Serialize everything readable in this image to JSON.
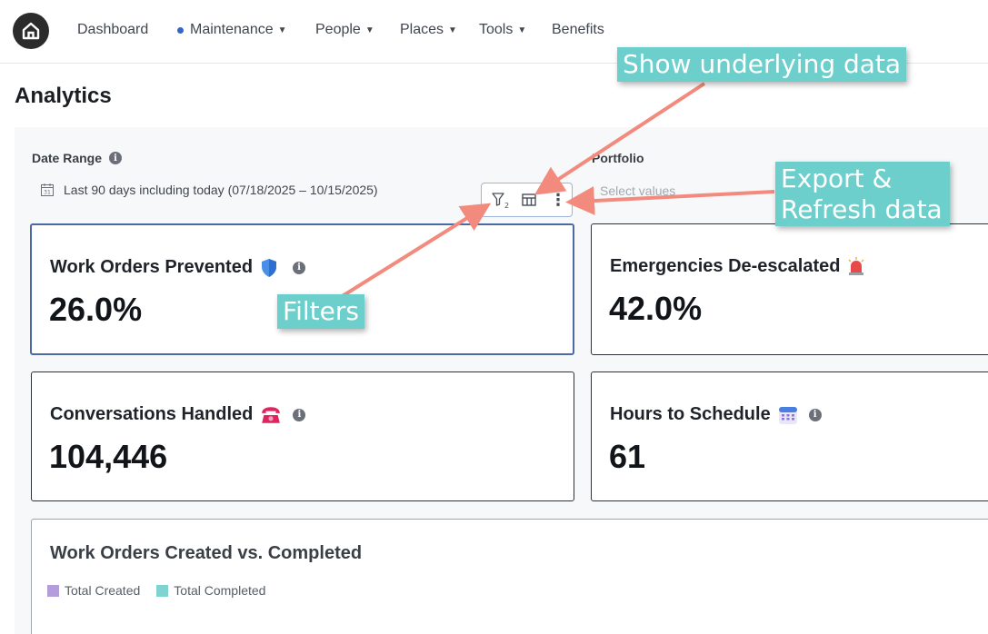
{
  "nav": {
    "logo": "home-logo",
    "items": [
      {
        "label": "Dashboard",
        "dropdown": false
      },
      {
        "label": "Maintenance",
        "dropdown": true,
        "active": true
      },
      {
        "label": "People",
        "dropdown": true
      },
      {
        "label": "Places",
        "dropdown": true
      },
      {
        "label": "Tools",
        "dropdown": true
      },
      {
        "label": "Benefits",
        "dropdown": false
      }
    ]
  },
  "page": {
    "title": "Analytics"
  },
  "filters": {
    "date_range": {
      "label": "Date Range",
      "value": "Last 90 days including today (07/18/2025 – 10/15/2025)"
    },
    "portfolio": {
      "label": "Portfolio",
      "placeholder": "Select values"
    }
  },
  "toolbar": {
    "filter_count": "2",
    "icons": [
      "filter-icon",
      "table-icon",
      "more-vertical-icon"
    ]
  },
  "cards": [
    {
      "title": "Work Orders Prevented",
      "value": "26.0%",
      "icon": "shield-icon"
    },
    {
      "title": "Emergencies De-escalated",
      "value": "42.0%",
      "icon": "siren-icon"
    },
    {
      "title": "Conversations Handled",
      "value": "104,446",
      "icon": "telephone-icon"
    },
    {
      "title": "Hours to Schedule",
      "value": "61",
      "icon": "calendar-icon"
    }
  ],
  "chart": {
    "title": "Work Orders Created vs. Completed",
    "legend": [
      {
        "label": "Total Created",
        "color": "#b39ddb"
      },
      {
        "label": "Total Completed",
        "color": "#7fd3d1"
      }
    ]
  },
  "annotations": {
    "show_data": "Show underlying data",
    "export_line1": "Export &",
    "export_line2": "Refresh data",
    "filters": "Filters"
  },
  "colors": {
    "accent": "#3366cc",
    "callout": "#6ccfcb",
    "arrow": "#f28b7d"
  }
}
